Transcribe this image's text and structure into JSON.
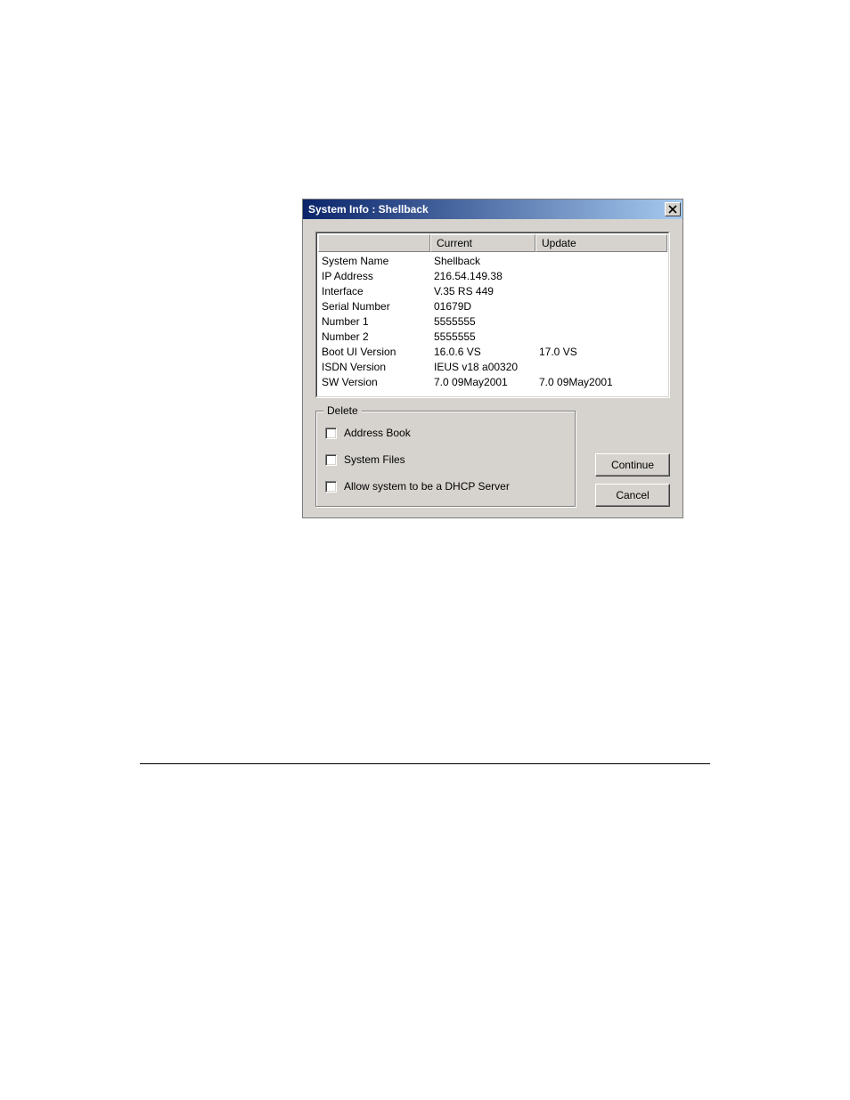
{
  "dialog": {
    "title": "System Info : Shellback",
    "headers": {
      "blank": "",
      "current": "Current",
      "update": "Update"
    },
    "rows": [
      {
        "label": "System Name",
        "current": "Shellback",
        "update": ""
      },
      {
        "label": "IP Address",
        "current": "216.54.149.38",
        "update": ""
      },
      {
        "label": "Interface",
        "current": "V.35 RS 449",
        "update": ""
      },
      {
        "label": "Serial Number",
        "current": "01679D",
        "update": ""
      },
      {
        "label": "Number 1",
        "current": "5555555",
        "update": ""
      },
      {
        "label": "Number 2",
        "current": "5555555",
        "update": ""
      },
      {
        "label": "Boot UI Version",
        "current": "16.0.6 VS",
        "update": "17.0 VS"
      },
      {
        "label": "ISDN Version",
        "current": "IEUS v18 a00320",
        "update": ""
      },
      {
        "label": "SW Version",
        "current": "7.0 09May2001",
        "update": "7.0 09May2001"
      }
    ],
    "delete_group": {
      "legend": "Delete",
      "checkboxes": {
        "address_book": "Address Book",
        "system_files": "System Files",
        "allow_dhcp": "Allow system to be a DHCP Server"
      }
    },
    "buttons": {
      "continue": "Continue",
      "cancel": "Cancel"
    }
  }
}
